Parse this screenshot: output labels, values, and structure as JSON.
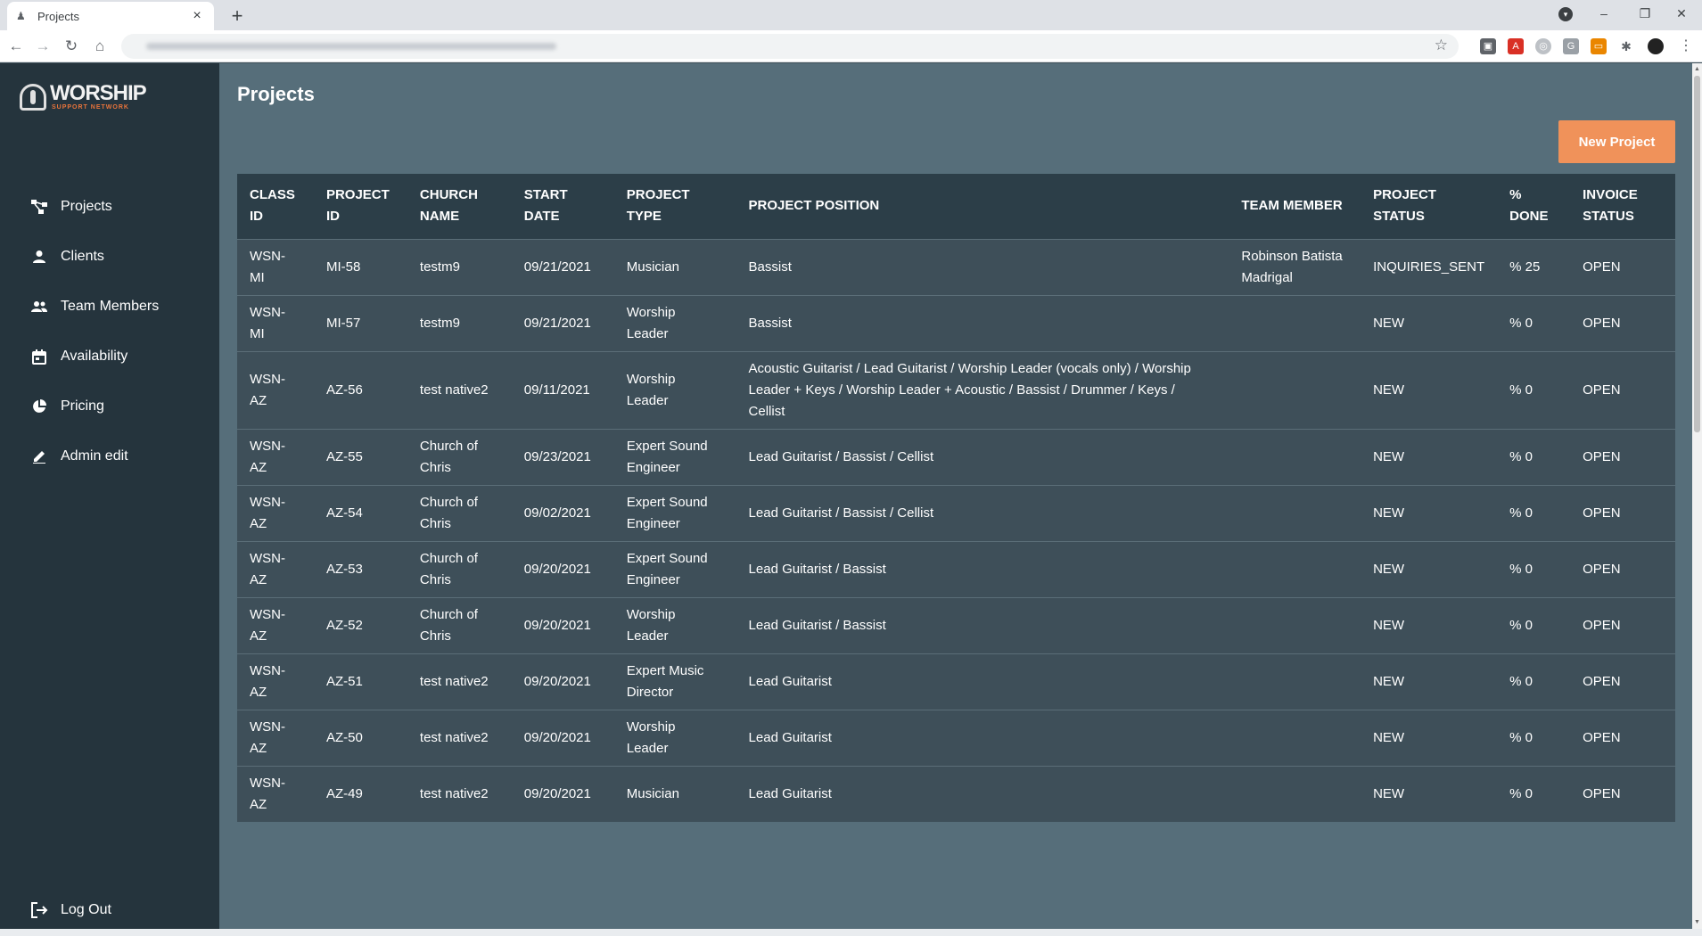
{
  "browser": {
    "tab_title": "Projects",
    "tab_close": "×",
    "new_tab": "+",
    "minimize": "–",
    "restore": "❐",
    "close": "✕"
  },
  "sidebar": {
    "logo_word": "WORSHIP",
    "logo_sub": "SUPPORT NETWORK",
    "items": [
      {
        "label": "Projects",
        "icon": "projects-icon"
      },
      {
        "label": "Clients",
        "icon": "person-icon"
      },
      {
        "label": "Team Members",
        "icon": "people-icon"
      },
      {
        "label": "Availability",
        "icon": "calendar-icon"
      },
      {
        "label": "Pricing",
        "icon": "pie-chart-icon"
      },
      {
        "label": "Admin edit",
        "icon": "pencil-icon"
      }
    ],
    "logout": "Log Out"
  },
  "main": {
    "title": "Projects",
    "new_project_label": "New Project",
    "columns": [
      [
        "CLASS",
        "ID"
      ],
      [
        "PROJECT",
        "ID"
      ],
      [
        "CHURCH",
        "NAME"
      ],
      [
        "START",
        "DATE"
      ],
      [
        "PROJECT",
        "TYPE"
      ],
      [
        "PROJECT POSITION"
      ],
      [
        "TEAM MEMBER"
      ],
      [
        "PROJECT",
        "STATUS"
      ],
      [
        "%",
        "DONE"
      ],
      [
        "INVOICE",
        "STATUS"
      ]
    ],
    "rows": [
      {
        "class_id": [
          "WSN-",
          "MI"
        ],
        "project_id": "MI-58",
        "church": [
          "testm9"
        ],
        "start": "09/21/2021",
        "type": [
          "Musician"
        ],
        "position": [
          "Bassist"
        ],
        "member": [
          "Robinson Batista",
          "Madrigal"
        ],
        "status": "INQUIRIES_SENT",
        "done": "% 25",
        "invoice": "OPEN"
      },
      {
        "class_id": [
          "WSN-",
          "MI"
        ],
        "project_id": "MI-57",
        "church": [
          "testm9"
        ],
        "start": "09/21/2021",
        "type": [
          "Worship",
          "Leader"
        ],
        "position": [
          "Bassist"
        ],
        "member": [],
        "status": "NEW",
        "done": "% 0",
        "invoice": "OPEN"
      },
      {
        "class_id": [
          "WSN-",
          "AZ"
        ],
        "project_id": "AZ-56",
        "church": [
          "test native2"
        ],
        "start": "09/11/2021",
        "type": [
          "Worship",
          "Leader"
        ],
        "position": [
          "Acoustic Guitarist / Lead Guitarist / Worship Leader (vocals only) / Worship",
          "Leader + Keys / Worship Leader + Acoustic / Bassist / Drummer / Keys /",
          "Cellist"
        ],
        "member": [],
        "status": "NEW",
        "done": "% 0",
        "invoice": "OPEN"
      },
      {
        "class_id": [
          "WSN-",
          "AZ"
        ],
        "project_id": "AZ-55",
        "church": [
          "Church of",
          "Chris"
        ],
        "start": "09/23/2021",
        "type": [
          "Expert Sound",
          "Engineer"
        ],
        "position": [
          "Lead Guitarist / Bassist / Cellist"
        ],
        "member": [],
        "status": "NEW",
        "done": "% 0",
        "invoice": "OPEN"
      },
      {
        "class_id": [
          "WSN-",
          "AZ"
        ],
        "project_id": "AZ-54",
        "church": [
          "Church of",
          "Chris"
        ],
        "start": "09/02/2021",
        "type": [
          "Expert Sound",
          "Engineer"
        ],
        "position": [
          "Lead Guitarist / Bassist / Cellist"
        ],
        "member": [],
        "status": "NEW",
        "done": "% 0",
        "invoice": "OPEN"
      },
      {
        "class_id": [
          "WSN-",
          "AZ"
        ],
        "project_id": "AZ-53",
        "church": [
          "Church of",
          "Chris"
        ],
        "start": "09/20/2021",
        "type": [
          "Expert Sound",
          "Engineer"
        ],
        "position": [
          "Lead Guitarist / Bassist"
        ],
        "member": [],
        "status": "NEW",
        "done": "% 0",
        "invoice": "OPEN"
      },
      {
        "class_id": [
          "WSN-",
          "AZ"
        ],
        "project_id": "AZ-52",
        "church": [
          "Church of",
          "Chris"
        ],
        "start": "09/20/2021",
        "type": [
          "Worship",
          "Leader"
        ],
        "position": [
          "Lead Guitarist / Bassist"
        ],
        "member": [],
        "status": "NEW",
        "done": "% 0",
        "invoice": "OPEN"
      },
      {
        "class_id": [
          "WSN-",
          "AZ"
        ],
        "project_id": "AZ-51",
        "church": [
          "test native2"
        ],
        "start": "09/20/2021",
        "type": [
          "Expert Music",
          "Director"
        ],
        "position": [
          "Lead Guitarist"
        ],
        "member": [],
        "status": "NEW",
        "done": "% 0",
        "invoice": "OPEN"
      },
      {
        "class_id": [
          "WSN-",
          "AZ"
        ],
        "project_id": "AZ-50",
        "church": [
          "test native2"
        ],
        "start": "09/20/2021",
        "type": [
          "Worship",
          "Leader"
        ],
        "position": [
          "Lead Guitarist"
        ],
        "member": [],
        "status": "NEW",
        "done": "% 0",
        "invoice": "OPEN"
      },
      {
        "class_id": [
          "WSN-",
          "AZ"
        ],
        "project_id": "AZ-49",
        "church": [
          "test native2"
        ],
        "start": "09/20/2021",
        "type": [
          "Musician"
        ],
        "position": [
          "Lead Guitarist"
        ],
        "member": [],
        "status": "NEW",
        "done": "% 0",
        "invoice": "OPEN"
      }
    ]
  }
}
